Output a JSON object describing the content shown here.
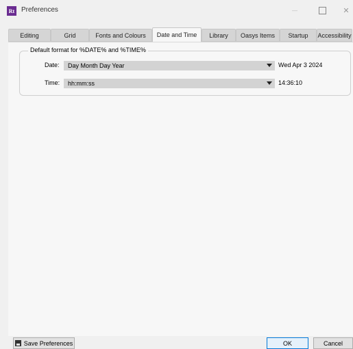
{
  "window": {
    "app_icon_text": "Rt",
    "title": "Preferences",
    "minimize_glyph": "—",
    "close_glyph": "✕"
  },
  "tabs": [
    {
      "label": "Editing"
    },
    {
      "label": "Grid"
    },
    {
      "label": "Fonts and Colours"
    },
    {
      "label": "Date and Time",
      "active": true
    },
    {
      "label": "Library"
    },
    {
      "label": "Oasys Items"
    },
    {
      "label": "Startup"
    },
    {
      "label": "Accessibility"
    }
  ],
  "group": {
    "title": "Default format for %DATE% and %TIME%",
    "date_label": "Date:",
    "date_value": "Day Month Day Year",
    "date_preview": "Wed Apr 3 2024",
    "time_label": "Time:",
    "time_value": "hh:mm:ss",
    "time_preview": "14:36:10"
  },
  "footer": {
    "save_label": "Save Preferences",
    "ok_label": "OK",
    "cancel_label": "Cancel"
  },
  "colors": {
    "app_icon": "#6a2c91",
    "ok_border": "#0078d7"
  }
}
